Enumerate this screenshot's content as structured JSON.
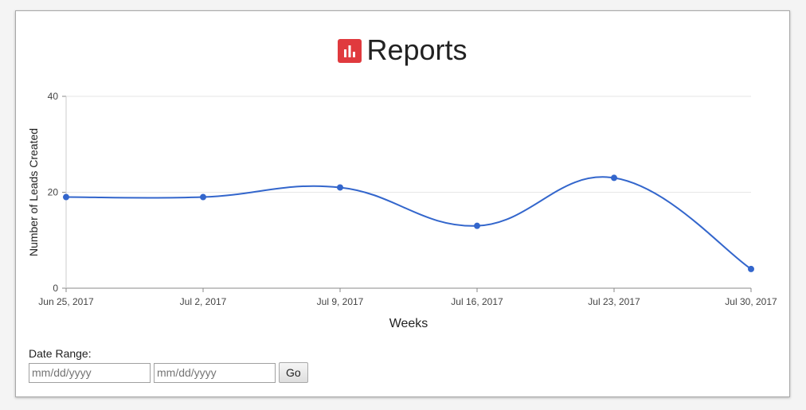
{
  "header": {
    "title": "Reports",
    "icon": "bar-chart-icon",
    "icon_color": "#e03a3e"
  },
  "chart_data": {
    "type": "line",
    "categories": [
      "Jun 25, 2017",
      "Jul 2, 2017",
      "Jul 9, 2017",
      "Jul 16, 2017",
      "Jul 23, 2017",
      "Jul 30, 2017"
    ],
    "series": [
      {
        "values": [
          19,
          19,
          21,
          13,
          23,
          4
        ]
      }
    ],
    "xlabel": "Weeks",
    "ylabel": "Number of Leads Created",
    "ylim": [
      0,
      40
    ],
    "yticks": [
      0,
      20,
      40
    ],
    "smooth": true,
    "grid": true,
    "line_color": "#3366cc"
  },
  "date_range": {
    "label": "Date Range:",
    "start_placeholder": "mm/dd/yyyy",
    "end_placeholder": "mm/dd/yyyy",
    "go_label": "Go"
  }
}
